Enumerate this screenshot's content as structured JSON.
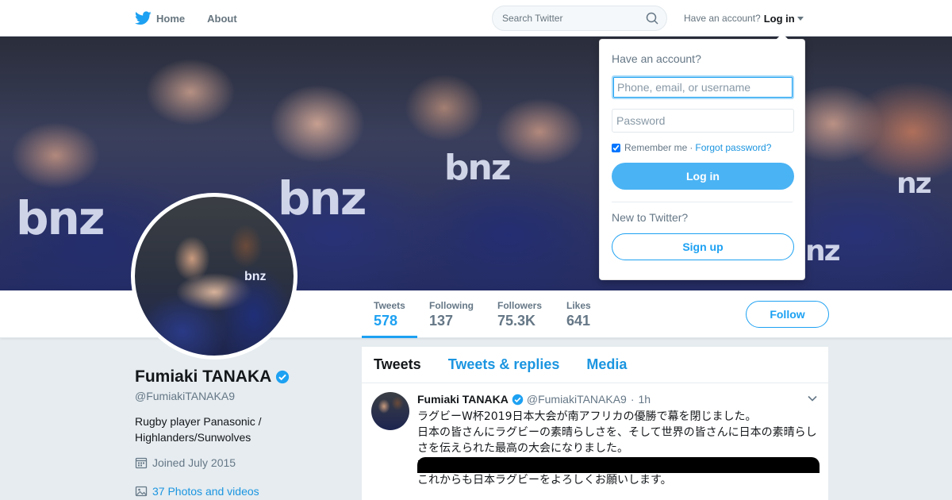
{
  "nav": {
    "home_label": "Home",
    "about_label": "About",
    "search_placeholder": "Search Twitter",
    "have_account": "Have an account?",
    "login_label": "Log in"
  },
  "banner": {
    "logos": [
      "bnz",
      "bnz",
      "bnz",
      "nz",
      "nz"
    ]
  },
  "stats": [
    {
      "label": "Tweets",
      "value": "578"
    },
    {
      "label": "Following",
      "value": "137"
    },
    {
      "label": "Followers",
      "value": "75.3K"
    },
    {
      "label": "Likes",
      "value": "641"
    }
  ],
  "follow_label": "Follow",
  "avatar": {
    "logo": "bnz"
  },
  "profile": {
    "name": "Fumiaki TANAKA",
    "screen_name": "@FumiakiTANAKA9",
    "bio": "Rugby player Panasonic / Highlanders/Sunwolves",
    "joined": "Joined July 2015",
    "photos": "37 Photos and videos"
  },
  "timeline": {
    "tabs": [
      "Tweets",
      "Tweets & replies",
      "Media"
    ],
    "tweet": {
      "name": "Fumiaki TANAKA",
      "handle": "@FumiakiTANAKA9",
      "separator": "·",
      "time": "1h",
      "text": "ラグビーW杯2019日本大会が南アフリカの優勝で幕を閉じました。\n日本の皆さんにラグビーの素晴らしさを、そして世界の皆さんに日本の素晴らしさを伝えられた最高の大会になりました。\n本当にありがとうございました。\nこれからも日本ラグビーをよろしくお願いします。"
    }
  },
  "login_dropdown": {
    "heading": "Have an account?",
    "username_placeholder": "Phone, email, or username",
    "password_placeholder": "Password",
    "remember_label": "Remember me",
    "separator": "·",
    "forgot_label": "Forgot password?",
    "login_button": "Log in",
    "new_label": "New to Twitter?",
    "signup_button": "Sign up"
  },
  "colors": {
    "accent": "#1da1f2",
    "link": "#1b95e0",
    "background": "#e6ecf0"
  },
  "icons": [
    "twitter-bird-icon",
    "search-icon",
    "verified-icon",
    "calendar-icon",
    "image-icon",
    "chevron-down-icon"
  ]
}
